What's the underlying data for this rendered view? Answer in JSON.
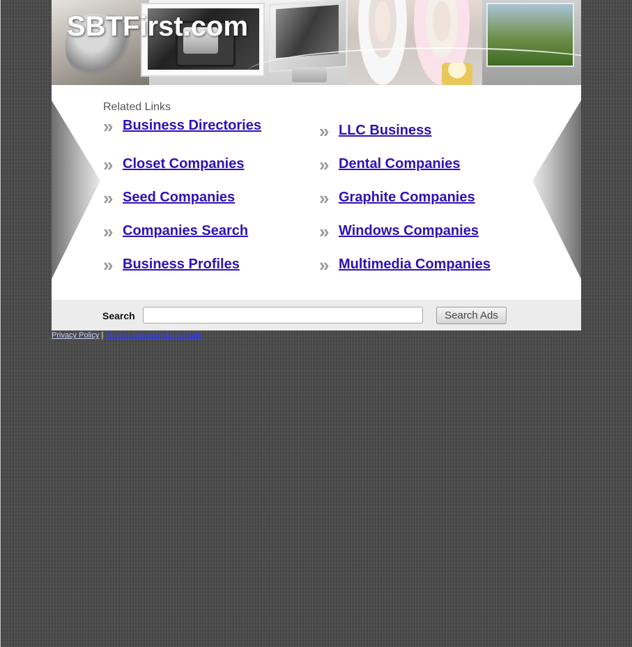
{
  "header": {
    "site_title": "SBTFirst.com"
  },
  "related": {
    "title": "Related Links",
    "left_links": [
      {
        "label": "Business Directories"
      },
      {
        "label": "Closet Companies"
      },
      {
        "label": "Seed Companies"
      },
      {
        "label": "Companies Search"
      },
      {
        "label": "Business Profiles"
      }
    ],
    "right_links": [
      {
        "label": "LLC Business"
      },
      {
        "label": "Dental Companies"
      },
      {
        "label": "Graphite Companies"
      },
      {
        "label": "Windows Companies"
      },
      {
        "label": "Multimedia Companies"
      }
    ],
    "arrow_glyph": "»"
  },
  "search": {
    "label": "Search",
    "value": "",
    "button_label": "Search Ads"
  },
  "footer": {
    "privacy_label": "Privacy Policy",
    "separator": "|",
    "sale_label": "This domain may be for sale"
  },
  "colors": {
    "link": "#2b13b5",
    "background": "#4a4a4a",
    "search_bar": "#ececec"
  }
}
